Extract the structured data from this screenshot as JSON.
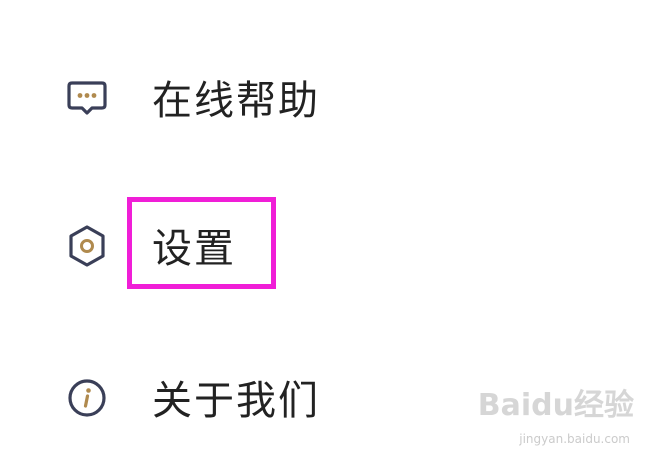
{
  "menu": {
    "items": [
      {
        "id": "help",
        "label": "在线帮助",
        "icon": "chat-bubble-icon"
      },
      {
        "id": "settings",
        "label": "设置",
        "icon": "hexagon-settings-icon",
        "highlighted": true
      },
      {
        "id": "about",
        "label": "关于我们",
        "icon": "info-icon"
      }
    ]
  },
  "colors": {
    "icon_stroke": "#3a3f58",
    "icon_accent": "#b08a4e",
    "label_text": "#222222",
    "highlight_border": "#f01ed7",
    "background": "#ffffff"
  },
  "watermark": {
    "brand": "Baidu经验",
    "domain": "jingyan.baidu.com"
  }
}
